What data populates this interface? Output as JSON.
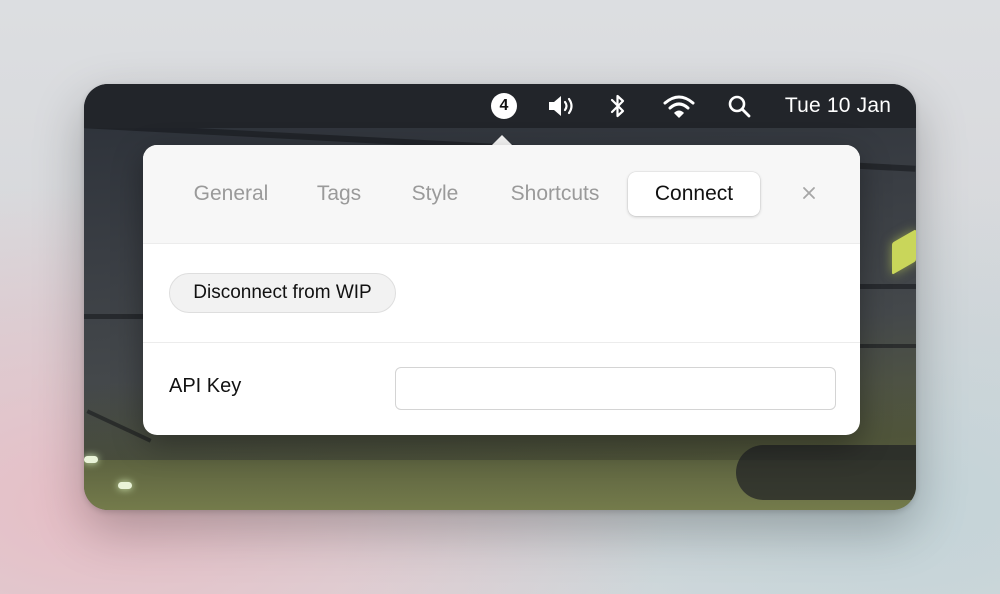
{
  "menubar": {
    "notification_count": "4",
    "icons": [
      "volume-icon",
      "bluetooth-icon",
      "wifi-icon",
      "search-icon"
    ],
    "clock": "Tue 10 Jan"
  },
  "popover": {
    "tabs": [
      {
        "label": "General",
        "active": false
      },
      {
        "label": "Tags",
        "active": false
      },
      {
        "label": "Style",
        "active": false
      },
      {
        "label": "Shortcuts",
        "active": false
      },
      {
        "label": "Connect",
        "active": true
      }
    ],
    "close_symbol": "×",
    "disconnect_button": "Disconnect from WIP",
    "api_key": {
      "label": "API Key",
      "value": "",
      "placeholder": ""
    }
  },
  "colors": {
    "menubar_bg": "#22252a",
    "popover_bg": "#ffffff",
    "tabbar_bg": "#f7f7f7",
    "inactive_tab_text": "#9a9a9a",
    "active_tab_text": "#111111"
  }
}
